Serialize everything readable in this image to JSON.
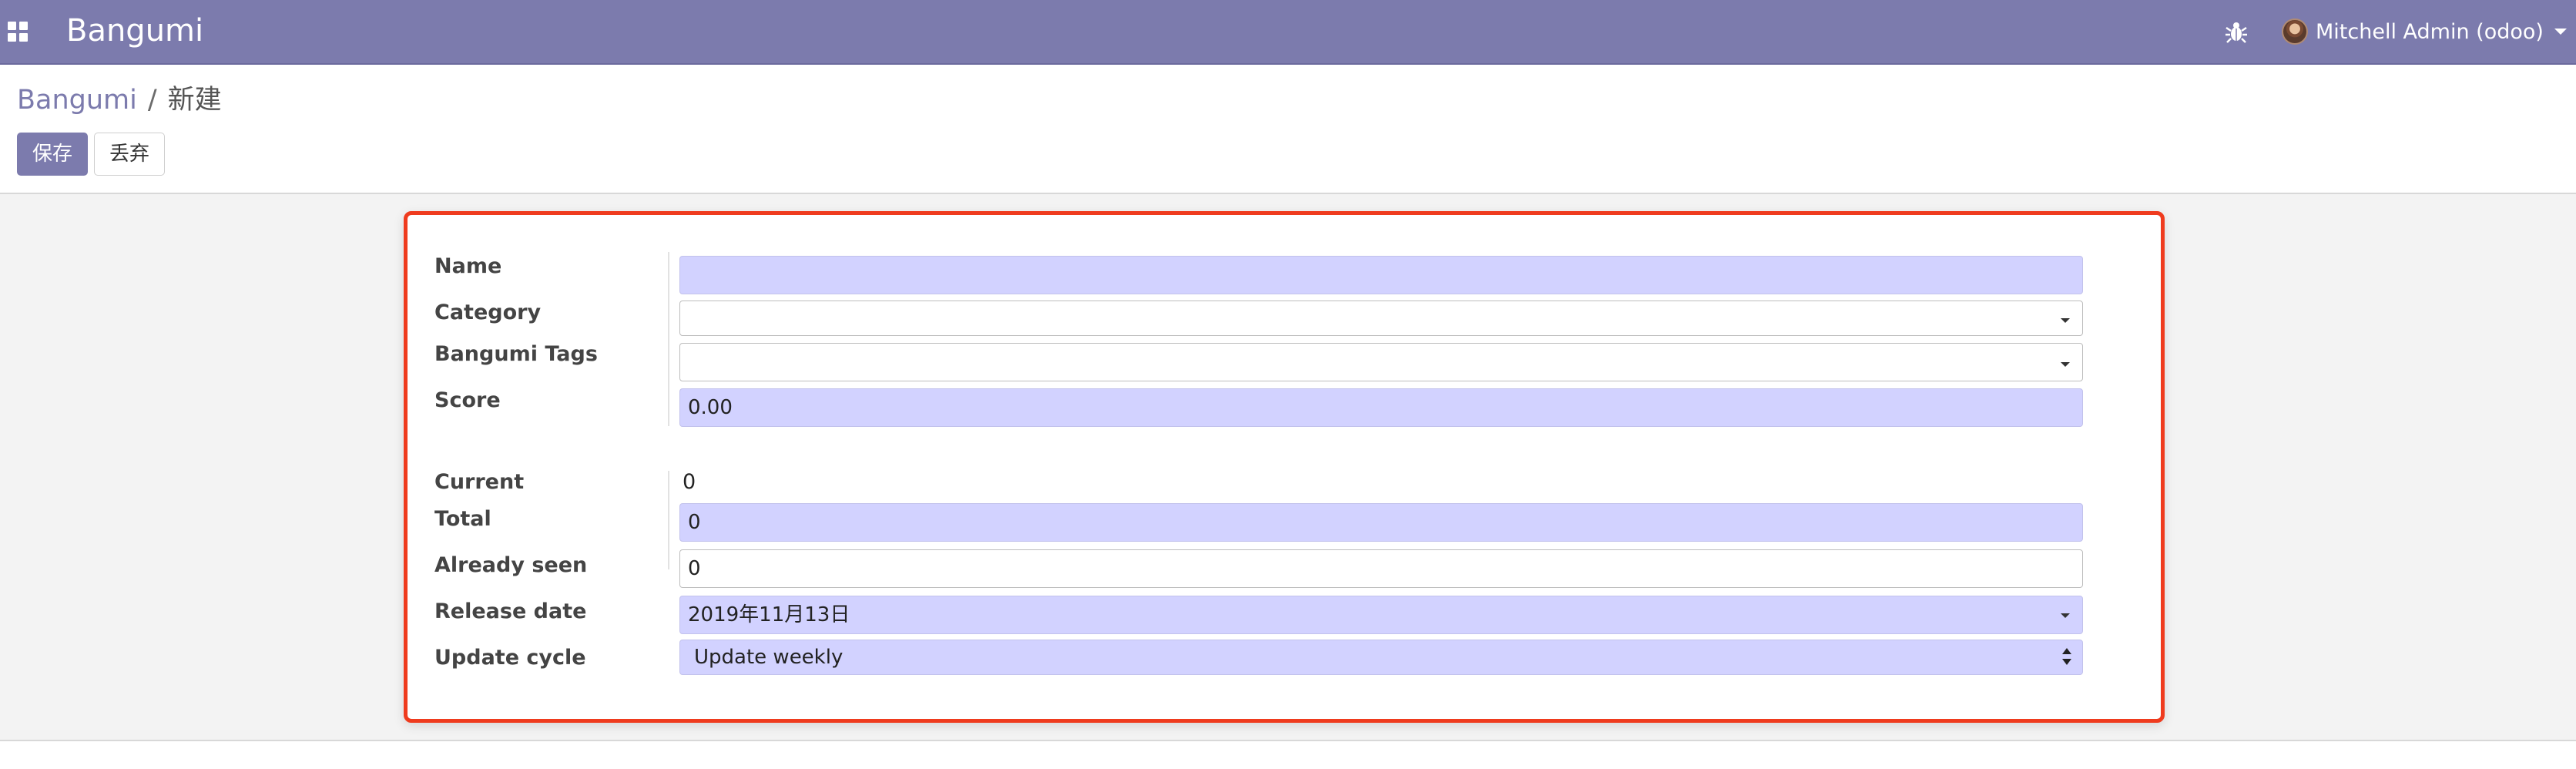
{
  "navbar": {
    "brand": "Bangumi",
    "user_name": "Mitchell Admin (odoo)",
    "icons": {
      "apps": "apps-grid-icon",
      "debug": "bug-icon",
      "user_dropdown": "caret-down-icon"
    },
    "color": "#7c7bad"
  },
  "control_panel": {
    "breadcrumb": {
      "parent": "Bangumi",
      "separator": "/",
      "current": "新建"
    },
    "buttons": {
      "save": "保存",
      "discard": "丢弃"
    }
  },
  "form": {
    "highlight_color": "#ef3b1e",
    "group1": [
      {
        "label": "Name",
        "value": "",
        "type": "char",
        "required": true
      },
      {
        "label": "Category",
        "value": "",
        "type": "many2one",
        "required": false
      },
      {
        "label": "Bangumi Tags",
        "value": "",
        "type": "many2many",
        "required": false
      },
      {
        "label": "Score",
        "value": "0.00",
        "type": "float",
        "required": true
      }
    ],
    "group2": [
      {
        "label": "Current",
        "value": "0",
        "type": "readonly"
      },
      {
        "label": "Total",
        "value": "0",
        "type": "integer",
        "required": true
      },
      {
        "label": "Already seen",
        "value": "0",
        "type": "integer",
        "required": false
      },
      {
        "label": "Release date",
        "value": "2019年11月13日",
        "type": "date",
        "required": true
      },
      {
        "label": "Update cycle",
        "value": "Update weekly",
        "type": "selection",
        "required": true
      }
    ]
  }
}
